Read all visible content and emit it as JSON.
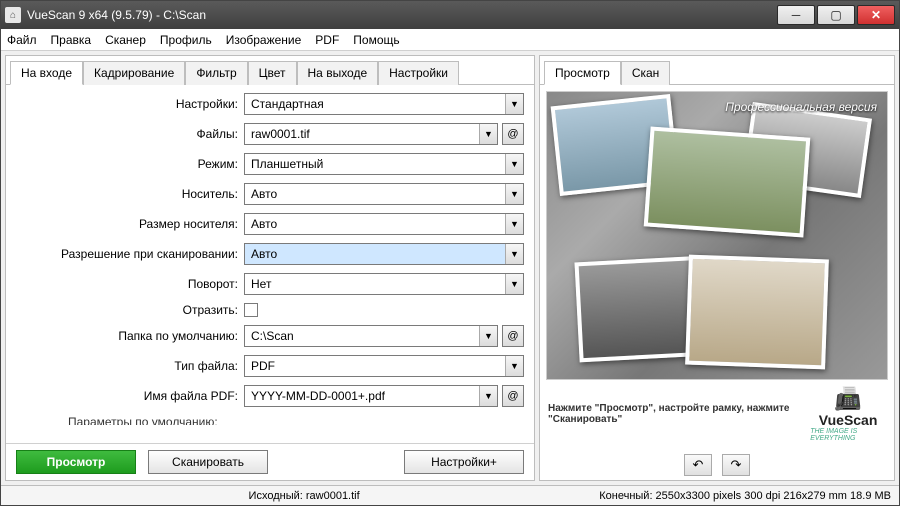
{
  "title": "VueScan 9 x64 (9.5.79) - C:\\Scan",
  "menu": [
    "Файл",
    "Правка",
    "Сканер",
    "Профиль",
    "Изображение",
    "PDF",
    "Помощь"
  ],
  "leftTabs": [
    "На входе",
    "Кадрирование",
    "Фильтр",
    "Цвет",
    "На выходе",
    "Настройки"
  ],
  "rightTabs": [
    "Просмотр",
    "Скан"
  ],
  "fields": {
    "settings": {
      "label": "Настройки:",
      "value": "Стандартная"
    },
    "files": {
      "label": "Файлы:",
      "value": "raw0001.tif"
    },
    "mode": {
      "label": "Режим:",
      "value": "Планшетный"
    },
    "media": {
      "label": "Носитель:",
      "value": "Авто"
    },
    "mediasize": {
      "label": "Размер носителя:",
      "value": "Авто"
    },
    "resolution": {
      "label": "Разрешение при сканировании:",
      "value": "Авто"
    },
    "rotate": {
      "label": "Поворот:",
      "value": "Нет"
    },
    "mirror": {
      "label": "Отразить:"
    },
    "defaultfolder": {
      "label": "Папка по умолчанию:",
      "value": "C:\\Scan"
    },
    "filetype": {
      "label": "Тип файла:",
      "value": "PDF"
    },
    "pdfname": {
      "label": "Имя файла PDF:",
      "value": "YYYY-MM-DD-0001+.pdf"
    },
    "cutoff": {
      "label": "Параметры по умолчанию:"
    }
  },
  "buttons": {
    "preview": "Просмотр",
    "scan": "Сканировать",
    "settingsplus": "Настройки+"
  },
  "status": {
    "source": "Исходный: raw0001.tif",
    "target": "Конечный: 2550x3300 pixels 300 dpi 216x279 mm 18.9 MB"
  },
  "preview": {
    "version": "Профессиональная версия",
    "hint": "Нажмите \"Просмотр\", настройте рамку, нажмите \"Сканировать\"",
    "logoName": "VueScan",
    "logoTag": "THE IMAGE IS EVERYTHING"
  },
  "at": "@"
}
